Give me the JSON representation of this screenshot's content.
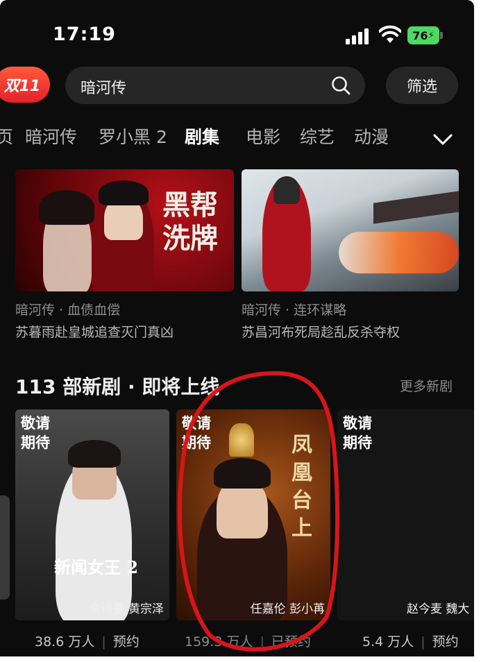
{
  "status_bar": {
    "time": "17:19",
    "battery": "76"
  },
  "search": {
    "promo_label": "双11",
    "query": "暗河传",
    "filter_label": "筛选"
  },
  "tabs": [
    {
      "label": "页"
    },
    {
      "label": "暗河传"
    },
    {
      "label": "罗小黑 2"
    },
    {
      "label": "剧集",
      "active": true
    },
    {
      "label": "电影"
    },
    {
      "label": "综艺"
    },
    {
      "label": "动漫"
    }
  ],
  "featured": [
    {
      "poster_text": "黑帮洗牌",
      "title": "暗河传 · 血债血偿",
      "subtitle": "苏暮雨赴皇城追查灭门真凶"
    },
    {
      "title": "暗河传 · 连环谋略",
      "subtitle": "苏昌河布死局趁乱反杀夺权"
    }
  ],
  "section": {
    "title": "113 部新剧 · 即将上线",
    "more": "更多新剧"
  },
  "upcoming": [
    {
      "badge": "敬请期待",
      "poster_text": "新闻女王 2",
      "cast": "佘诗曼 黄宗泽",
      "count": "38.6 万人",
      "action": "预约"
    },
    {
      "badge": "敬请期待",
      "poster_text": "凤凰台上",
      "cast": "任嘉伦 彭小苒",
      "count": "159.3 万人",
      "action": "已预约"
    },
    {
      "badge": "敬请期待",
      "cast": "赵今麦 魏大",
      "count": "5.4 万人",
      "action": "预约"
    }
  ],
  "colors": {
    "accent_red": "#e3202a",
    "background": "#0c0c0c",
    "annotation": "#d8151b"
  }
}
